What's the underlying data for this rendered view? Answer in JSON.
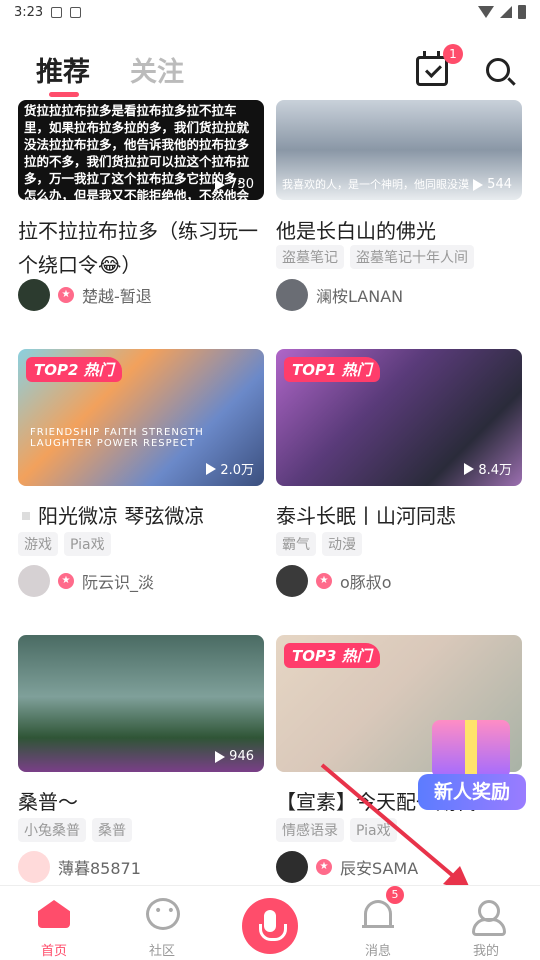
{
  "status_bar": {
    "time": "3:23"
  },
  "header": {
    "tab_recommend": "推荐",
    "tab_follow": "关注",
    "calendar_badge": "1"
  },
  "cards": [
    {
      "title": "拉不拉拉布拉多（练习玩一个绕口令😂）",
      "thumb_text": "货拉拉拉布拉多是看拉布拉多拉不拉车里，如果拉布拉多拉的多，我们货拉拉就没法拉拉布拉多，他告诉我他的拉布拉多拉的不多，我们货拉拉可以拉这个拉布拉多，万一我拉了这个拉布拉多它拉的多，怎么办，但是我又不能拒绝他，不然他会投诉我们，",
      "plays": "730",
      "tags": [],
      "author": "楚越-暂退"
    },
    {
      "title": "他是长白山的佛光",
      "thumb_text": "我喜欢的人，是一个神明，他同眼没漠",
      "plays": "544",
      "tags": [
        "盗墓笔记",
        "盗墓笔记十年人间"
      ],
      "author": "澜桉LANAN"
    },
    {
      "title": "阳光微凉 琴弦微凉",
      "badge": "TOP2 热门",
      "thumb_text": "FRIENDSHIP FAITH STRENGTH LAUGHTER POWER RESPECT",
      "plays": "2.0万",
      "tags": [
        "游戏",
        "Pia戏"
      ],
      "author": "阮云识_淡"
    },
    {
      "title": "泰斗长眠丨山河同悲",
      "badge": "TOP1 热门",
      "plays": "8.4万",
      "tags": [
        "霸气",
        "动漫"
      ],
      "author": "o豚叔o"
    },
    {
      "title": "桑普～",
      "plays": "946",
      "tags": [
        "小兔桑普",
        "桑普"
      ],
      "author": "薄暮85871"
    },
    {
      "title": "【宣素】今天配一期代",
      "badge": "TOP3 热门",
      "tags": [
        "情感语录",
        "Pia戏"
      ],
      "author": "辰安SAMA"
    }
  ],
  "reward": {
    "label": "新人奖励"
  },
  "nav": {
    "home": "首页",
    "community": "社区",
    "messages": "消息",
    "messages_badge": "5",
    "mine": "我的"
  },
  "colors": {
    "accent": "#ff4d6b",
    "arrow": "#e8334a"
  }
}
